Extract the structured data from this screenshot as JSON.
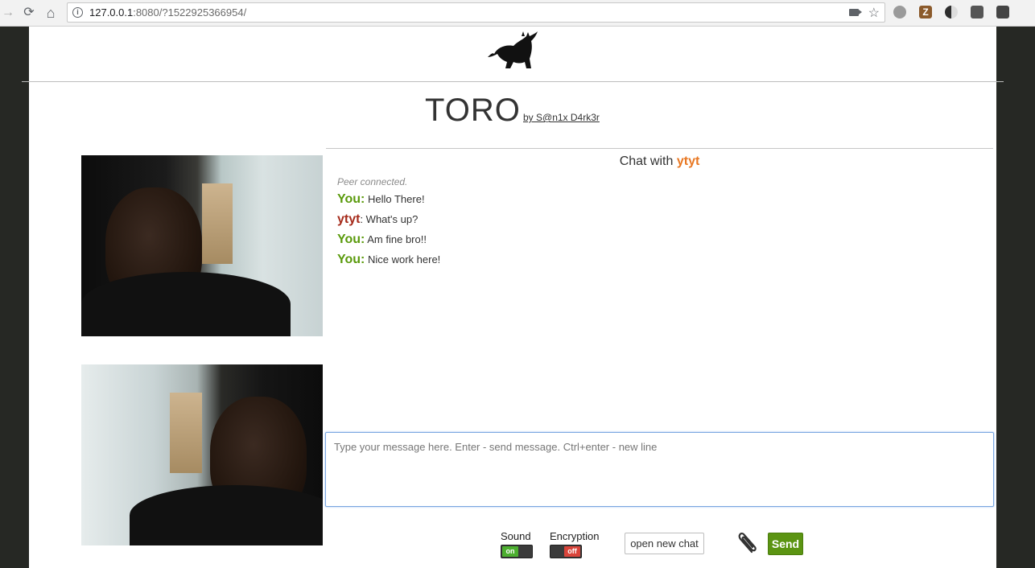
{
  "browser": {
    "url_host": "127.0.0.1",
    "url_rest": ":8080/?1522925366954/",
    "nav": {
      "back": "→",
      "reload": "⟳",
      "home": "⌂"
    },
    "info_icon": "i",
    "star_icon": "☆",
    "extension_colors": [
      "#9a9a9a",
      "#8b5a2b",
      "#2d2d2d",
      "#555555",
      "#444444"
    ]
  },
  "header": {
    "title": "TORO",
    "byline": "by S@n1x D4rk3r"
  },
  "chat": {
    "with_label": "Chat with",
    "peer_name": "ytyt",
    "system_message": "Peer connected.",
    "messages": [
      {
        "sender": "You:",
        "text": "Hello There!"
      },
      {
        "sender": "ytyt",
        "text": ": What's up?"
      },
      {
        "sender": "You:",
        "text": "Am fine bro!!"
      },
      {
        "sender": "You:",
        "text": "Nice work here!"
      }
    ],
    "input_placeholder": "Type your message here. Enter - send message. Ctrl+enter - new line",
    "input_value": ""
  },
  "controls": {
    "sound_label": "Sound",
    "sound_state": "on",
    "encryption_label": "Encryption",
    "encryption_state": "off",
    "new_chat_label": "open new chat",
    "send_label": "Send"
  },
  "colors": {
    "you": "#5a9a0c",
    "peer": "#a52a1a",
    "peer_highlight": "#e87722",
    "send_button": "#5b9412"
  }
}
